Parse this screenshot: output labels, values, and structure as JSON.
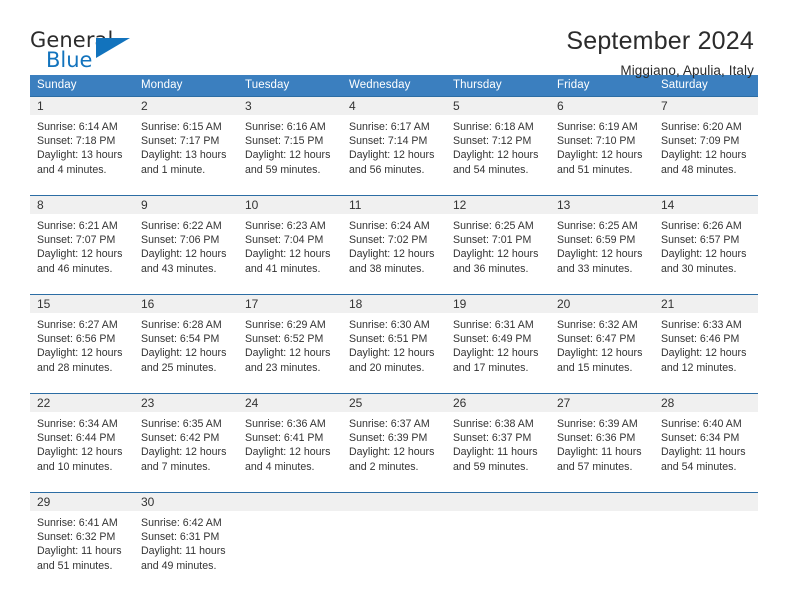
{
  "brand": {
    "name_top": "General",
    "name_bottom": "Blue",
    "accent_color": "#1273bd"
  },
  "header": {
    "title": "September 2024",
    "subtitle": "Miggiano, Apulia, Italy"
  },
  "theme": {
    "header_row_bg": "#3b7fbf",
    "daynum_bg": "#f0f0f0",
    "daynum_border": "#2c6da4",
    "text_color": "#333333"
  },
  "labels": {
    "sunrise_prefix": "Sunrise:",
    "sunset_prefix": "Sunset:",
    "daylight_prefix": "Daylight:"
  },
  "columns": [
    "Sunday",
    "Monday",
    "Tuesday",
    "Wednesday",
    "Thursday",
    "Friday",
    "Saturday"
  ],
  "weeks": [
    [
      {
        "day": "1",
        "sunrise": "Sunrise: 6:14 AM",
        "sunset": "Sunset: 7:18 PM",
        "daylight_line1": "Daylight: 13 hours",
        "daylight_line2": "and 4 minutes."
      },
      {
        "day": "2",
        "sunrise": "Sunrise: 6:15 AM",
        "sunset": "Sunset: 7:17 PM",
        "daylight_line1": "Daylight: 13 hours",
        "daylight_line2": "and 1 minute."
      },
      {
        "day": "3",
        "sunrise": "Sunrise: 6:16 AM",
        "sunset": "Sunset: 7:15 PM",
        "daylight_line1": "Daylight: 12 hours",
        "daylight_line2": "and 59 minutes."
      },
      {
        "day": "4",
        "sunrise": "Sunrise: 6:17 AM",
        "sunset": "Sunset: 7:14 PM",
        "daylight_line1": "Daylight: 12 hours",
        "daylight_line2": "and 56 minutes."
      },
      {
        "day": "5",
        "sunrise": "Sunrise: 6:18 AM",
        "sunset": "Sunset: 7:12 PM",
        "daylight_line1": "Daylight: 12 hours",
        "daylight_line2": "and 54 minutes."
      },
      {
        "day": "6",
        "sunrise": "Sunrise: 6:19 AM",
        "sunset": "Sunset: 7:10 PM",
        "daylight_line1": "Daylight: 12 hours",
        "daylight_line2": "and 51 minutes."
      },
      {
        "day": "7",
        "sunrise": "Sunrise: 6:20 AM",
        "sunset": "Sunset: 7:09 PM",
        "daylight_line1": "Daylight: 12 hours",
        "daylight_line2": "and 48 minutes."
      }
    ],
    [
      {
        "day": "8",
        "sunrise": "Sunrise: 6:21 AM",
        "sunset": "Sunset: 7:07 PM",
        "daylight_line1": "Daylight: 12 hours",
        "daylight_line2": "and 46 minutes."
      },
      {
        "day": "9",
        "sunrise": "Sunrise: 6:22 AM",
        "sunset": "Sunset: 7:06 PM",
        "daylight_line1": "Daylight: 12 hours",
        "daylight_line2": "and 43 minutes."
      },
      {
        "day": "10",
        "sunrise": "Sunrise: 6:23 AM",
        "sunset": "Sunset: 7:04 PM",
        "daylight_line1": "Daylight: 12 hours",
        "daylight_line2": "and 41 minutes."
      },
      {
        "day": "11",
        "sunrise": "Sunrise: 6:24 AM",
        "sunset": "Sunset: 7:02 PM",
        "daylight_line1": "Daylight: 12 hours",
        "daylight_line2": "and 38 minutes."
      },
      {
        "day": "12",
        "sunrise": "Sunrise: 6:25 AM",
        "sunset": "Sunset: 7:01 PM",
        "daylight_line1": "Daylight: 12 hours",
        "daylight_line2": "and 36 minutes."
      },
      {
        "day": "13",
        "sunrise": "Sunrise: 6:25 AM",
        "sunset": "Sunset: 6:59 PM",
        "daylight_line1": "Daylight: 12 hours",
        "daylight_line2": "and 33 minutes."
      },
      {
        "day": "14",
        "sunrise": "Sunrise: 6:26 AM",
        "sunset": "Sunset: 6:57 PM",
        "daylight_line1": "Daylight: 12 hours",
        "daylight_line2": "and 30 minutes."
      }
    ],
    [
      {
        "day": "15",
        "sunrise": "Sunrise: 6:27 AM",
        "sunset": "Sunset: 6:56 PM",
        "daylight_line1": "Daylight: 12 hours",
        "daylight_line2": "and 28 minutes."
      },
      {
        "day": "16",
        "sunrise": "Sunrise: 6:28 AM",
        "sunset": "Sunset: 6:54 PM",
        "daylight_line1": "Daylight: 12 hours",
        "daylight_line2": "and 25 minutes."
      },
      {
        "day": "17",
        "sunrise": "Sunrise: 6:29 AM",
        "sunset": "Sunset: 6:52 PM",
        "daylight_line1": "Daylight: 12 hours",
        "daylight_line2": "and 23 minutes."
      },
      {
        "day": "18",
        "sunrise": "Sunrise: 6:30 AM",
        "sunset": "Sunset: 6:51 PM",
        "daylight_line1": "Daylight: 12 hours",
        "daylight_line2": "and 20 minutes."
      },
      {
        "day": "19",
        "sunrise": "Sunrise: 6:31 AM",
        "sunset": "Sunset: 6:49 PM",
        "daylight_line1": "Daylight: 12 hours",
        "daylight_line2": "and 17 minutes."
      },
      {
        "day": "20",
        "sunrise": "Sunrise: 6:32 AM",
        "sunset": "Sunset: 6:47 PM",
        "daylight_line1": "Daylight: 12 hours",
        "daylight_line2": "and 15 minutes."
      },
      {
        "day": "21",
        "sunrise": "Sunrise: 6:33 AM",
        "sunset": "Sunset: 6:46 PM",
        "daylight_line1": "Daylight: 12 hours",
        "daylight_line2": "and 12 minutes."
      }
    ],
    [
      {
        "day": "22",
        "sunrise": "Sunrise: 6:34 AM",
        "sunset": "Sunset: 6:44 PM",
        "daylight_line1": "Daylight: 12 hours",
        "daylight_line2": "and 10 minutes."
      },
      {
        "day": "23",
        "sunrise": "Sunrise: 6:35 AM",
        "sunset": "Sunset: 6:42 PM",
        "daylight_line1": "Daylight: 12 hours",
        "daylight_line2": "and 7 minutes."
      },
      {
        "day": "24",
        "sunrise": "Sunrise: 6:36 AM",
        "sunset": "Sunset: 6:41 PM",
        "daylight_line1": "Daylight: 12 hours",
        "daylight_line2": "and 4 minutes."
      },
      {
        "day": "25",
        "sunrise": "Sunrise: 6:37 AM",
        "sunset": "Sunset: 6:39 PM",
        "daylight_line1": "Daylight: 12 hours",
        "daylight_line2": "and 2 minutes."
      },
      {
        "day": "26",
        "sunrise": "Sunrise: 6:38 AM",
        "sunset": "Sunset: 6:37 PM",
        "daylight_line1": "Daylight: 11 hours",
        "daylight_line2": "and 59 minutes."
      },
      {
        "day": "27",
        "sunrise": "Sunrise: 6:39 AM",
        "sunset": "Sunset: 6:36 PM",
        "daylight_line1": "Daylight: 11 hours",
        "daylight_line2": "and 57 minutes."
      },
      {
        "day": "28",
        "sunrise": "Sunrise: 6:40 AM",
        "sunset": "Sunset: 6:34 PM",
        "daylight_line1": "Daylight: 11 hours",
        "daylight_line2": "and 54 minutes."
      }
    ],
    [
      {
        "day": "29",
        "sunrise": "Sunrise: 6:41 AM",
        "sunset": "Sunset: 6:32 PM",
        "daylight_line1": "Daylight: 11 hours",
        "daylight_line2": "and 51 minutes."
      },
      {
        "day": "30",
        "sunrise": "Sunrise: 6:42 AM",
        "sunset": "Sunset: 6:31 PM",
        "daylight_line1": "Daylight: 11 hours",
        "daylight_line2": "and 49 minutes."
      },
      {
        "day": "",
        "sunrise": "",
        "sunset": "",
        "daylight_line1": "",
        "daylight_line2": ""
      },
      {
        "day": "",
        "sunrise": "",
        "sunset": "",
        "daylight_line1": "",
        "daylight_line2": ""
      },
      {
        "day": "",
        "sunrise": "",
        "sunset": "",
        "daylight_line1": "",
        "daylight_line2": ""
      },
      {
        "day": "",
        "sunrise": "",
        "sunset": "",
        "daylight_line1": "",
        "daylight_line2": ""
      },
      {
        "day": "",
        "sunrise": "",
        "sunset": "",
        "daylight_line1": "",
        "daylight_line2": ""
      }
    ]
  ]
}
